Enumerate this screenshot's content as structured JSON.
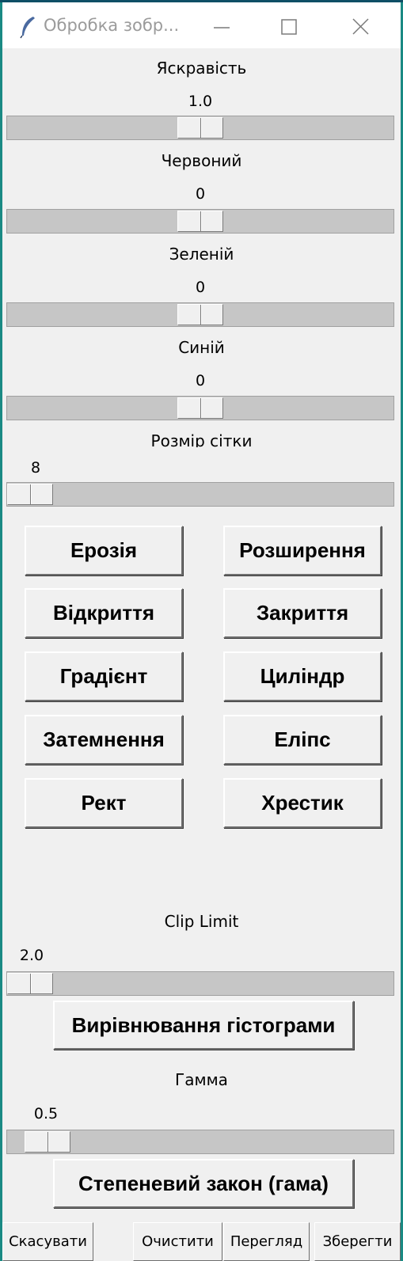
{
  "window": {
    "title": "Обробка зобр..."
  },
  "sliders": {
    "brightness": {
      "label": "Яскравість",
      "value": "1.0",
      "level": 0.5
    },
    "red": {
      "label": "Червоний",
      "value": "0",
      "level": 0.5
    },
    "green": {
      "label": "Зеленій",
      "value": "0",
      "level": 0.5
    },
    "blue": {
      "label": "Синій",
      "value": "0",
      "level": 0.5
    },
    "grid_size": {
      "label": "Розмір сітки",
      "value": "8",
      "level": 0.0
    },
    "clip_limit": {
      "label": "Clip Limit",
      "value": "2.0",
      "level": 0.0
    },
    "gamma": {
      "label": "Гамма",
      "value": "0.5",
      "level": 0.05
    }
  },
  "morph_buttons": {
    "erosion": "Ерозія",
    "dilation": "Розширення",
    "opening": "Відкриття",
    "closing": "Закриття",
    "gradient": "Градієнт",
    "tophat": "Циліндр",
    "blackhat": "Затемнення",
    "ellipse": "Еліпс",
    "rect": "Рект",
    "cross": "Хрестик"
  },
  "actions": {
    "histogram_equalization": "Вирівнювання гістограми",
    "power_law": "Степеневий закон (гама)"
  },
  "footer": {
    "cancel": "Скасувати",
    "clear": "Очистити",
    "preview": "Перегляд",
    "save": "Зберегти"
  },
  "colors": {
    "background": "#f0f0f0",
    "trough": "#c6c6c6",
    "titlebar": "#ffffff",
    "title_text": "#9b9b9b"
  },
  "icons": [
    "feather-icon",
    "minimize-icon",
    "maximize-icon",
    "close-icon"
  ]
}
